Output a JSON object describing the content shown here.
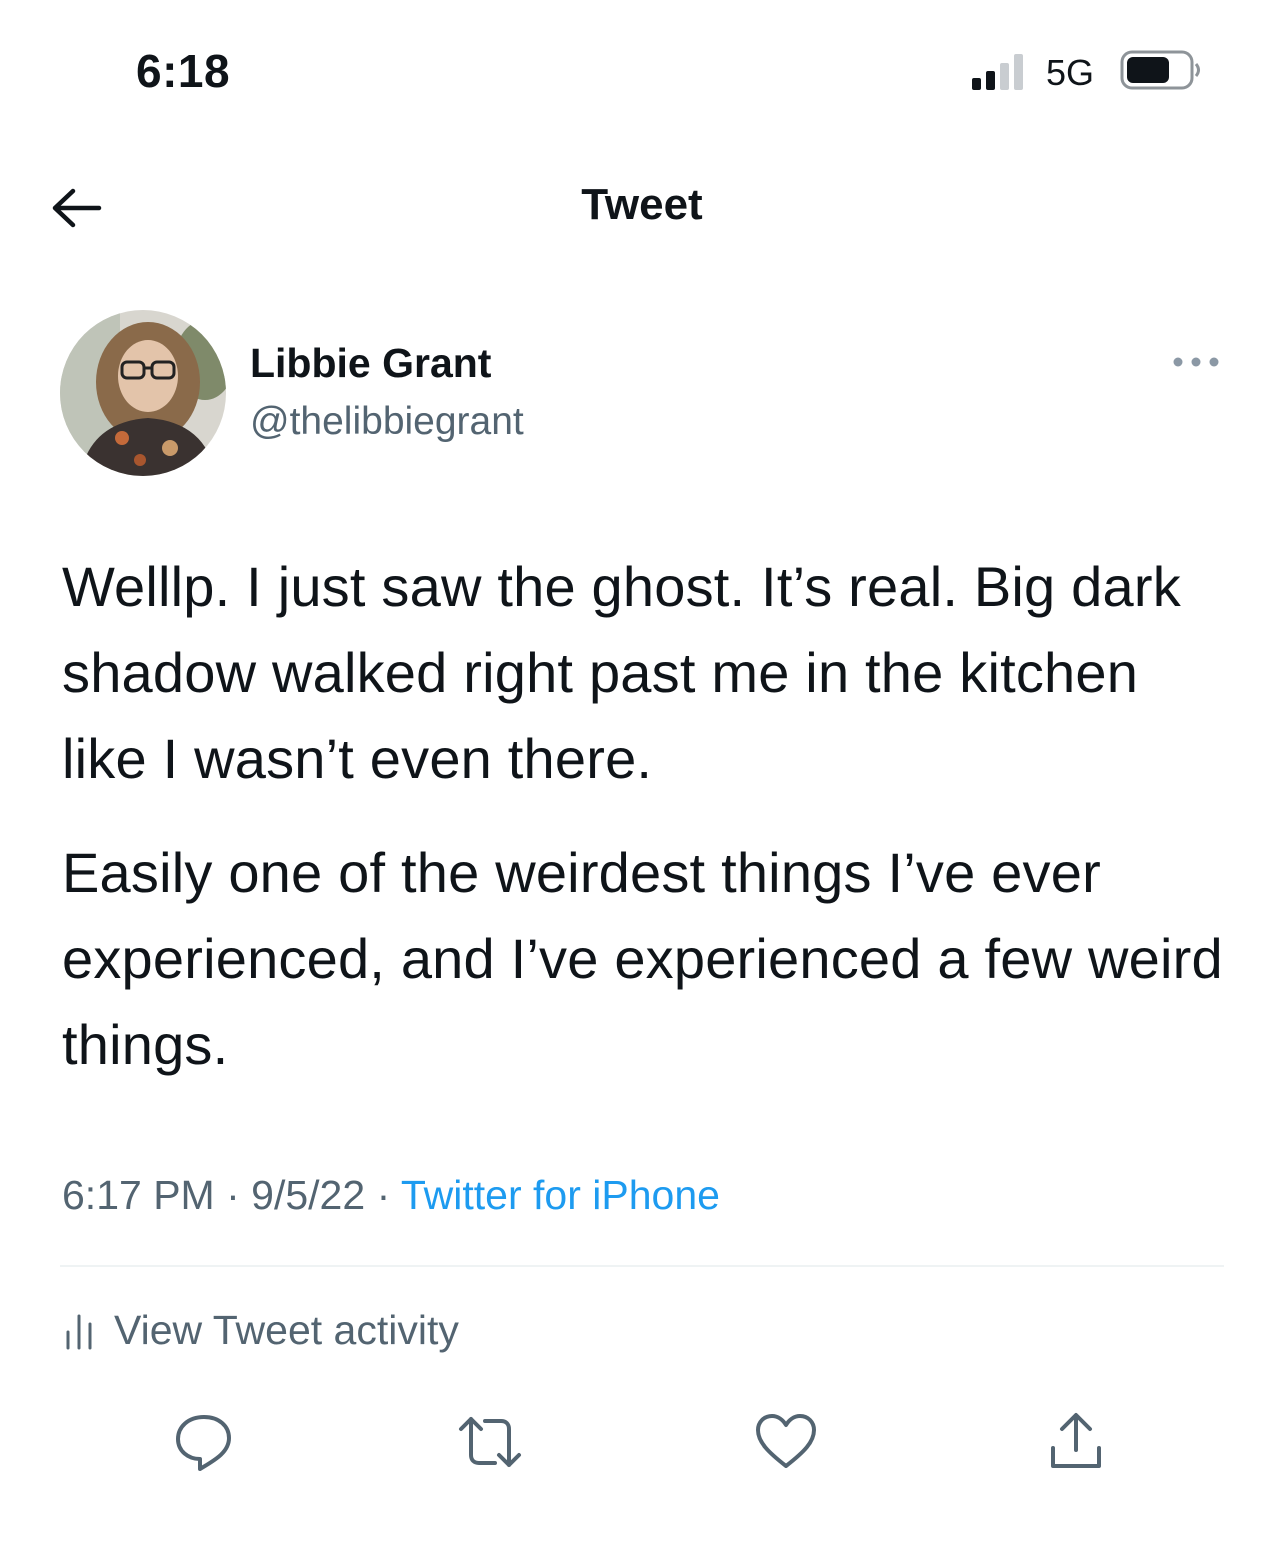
{
  "status_bar": {
    "time": "6:18",
    "network": "5G"
  },
  "header": {
    "title": "Tweet"
  },
  "author": {
    "name": "Libbie Grant",
    "handle": "@thelibbiegrant"
  },
  "tweet": {
    "paragraphs": [
      "Welllp. I just saw the ghost. It’s real. Big dark shadow walked right past me in the kitchen like I wasn’t even there.",
      "Easily one of the weirdest things I’ve ever experienced, and I’ve experienced a few weird things."
    ],
    "time": "6:17 PM",
    "separator": "·",
    "date": "9/5/22",
    "source": "Twitter for iPhone"
  },
  "activity": {
    "label": "View Tweet activity"
  },
  "actions": [
    "reply-icon",
    "retweet-icon",
    "like-icon",
    "share-icon"
  ],
  "colors": {
    "text": "#0f1419",
    "secondary": "#536471",
    "link": "#1d9bf0",
    "divider": "#eff3f4"
  }
}
